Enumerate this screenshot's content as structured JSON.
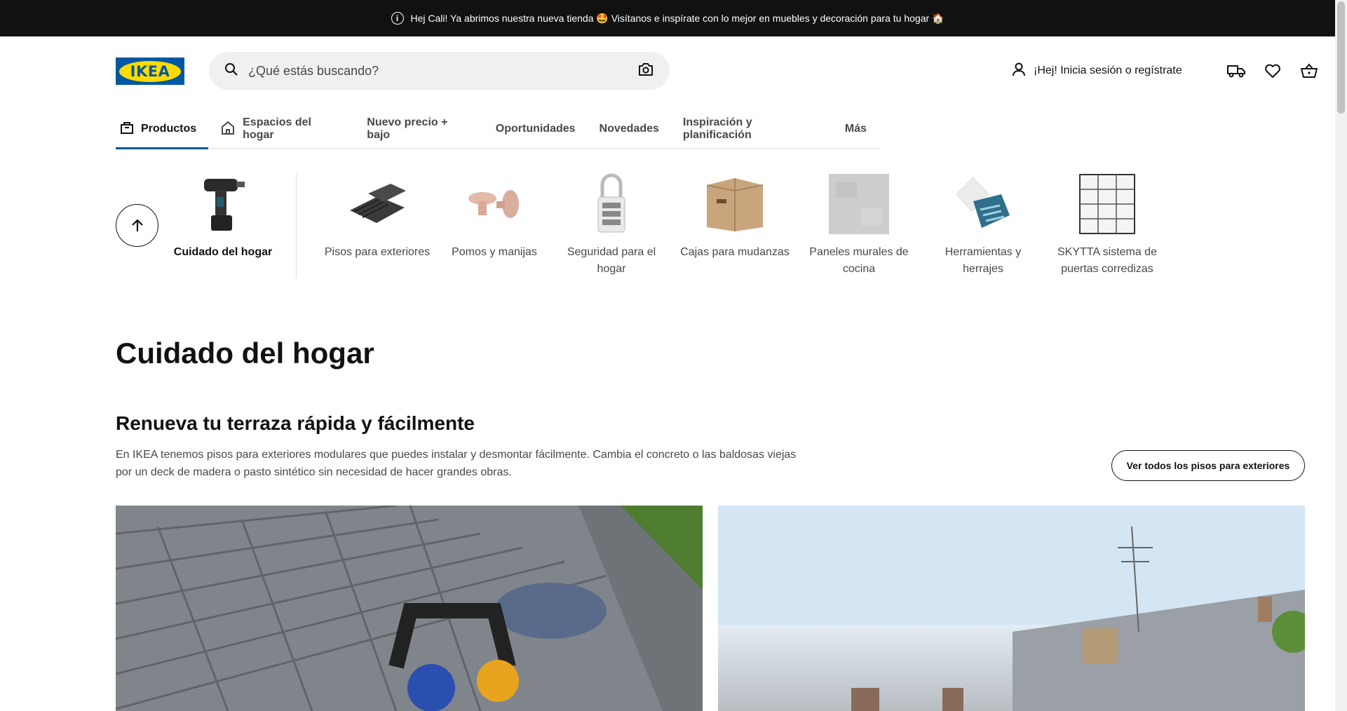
{
  "promo": {
    "text": "Hej Cali! Ya abrimos nuestra nueva tienda 🤩 Visítanos e inspírate con lo mejor en muebles y decoración para tu hogar 🏠"
  },
  "header": {
    "logo_text": "IKEA",
    "search_placeholder": "¿Qué estás buscando?",
    "login_label": "¡Hej! Inicia sesión o regístrate"
  },
  "nav": {
    "tabs": [
      {
        "label": "Productos",
        "icon": "shopping-bag-icon",
        "active": true
      },
      {
        "label": "Espacios del hogar",
        "icon": "home-icon",
        "active": false
      },
      {
        "label": "Nuevo precio + bajo"
      },
      {
        "label": "Oportunidades"
      },
      {
        "label": "Novedades"
      },
      {
        "label": "Inspiración y planificación"
      },
      {
        "label": "Más"
      }
    ]
  },
  "categories": {
    "current": {
      "label": "Cuidado del hogar",
      "icon": "drill-icon"
    },
    "items": [
      {
        "label": "Pisos para exteriores",
        "icon": "deck-tiles-icon"
      },
      {
        "label": "Pomos y manijas",
        "icon": "knobs-icon"
      },
      {
        "label": "Seguridad para el hogar",
        "icon": "padlock-icon"
      },
      {
        "label": "Cajas para mudanzas",
        "icon": "moving-box-icon"
      },
      {
        "label": "Paneles murales de cocina",
        "icon": "wall-panel-icon"
      },
      {
        "label": "Herramientas y herrajes",
        "icon": "toolkit-icon"
      },
      {
        "label": "SKYTTA sistema de puertas corredizas",
        "icon": "sliding-door-icon"
      }
    ]
  },
  "main": {
    "page_title": "Cuidado del hogar",
    "section_title": "Renueva tu terraza rápida y fácilmente",
    "section_desc": "En IKEA tenemos pisos para exteriores modulares que puedes instalar y desmontar fácilmente. Cambia el concreto o las baldosas viejas por un deck de madera o pasto sintético sin necesidad de hacer grandes obras.",
    "cta_label": "Ver todos los pisos para exteriores"
  },
  "colors": {
    "brand_blue": "#0058a3",
    "brand_yellow": "#ffdb00",
    "promo_bg": "#111111"
  }
}
